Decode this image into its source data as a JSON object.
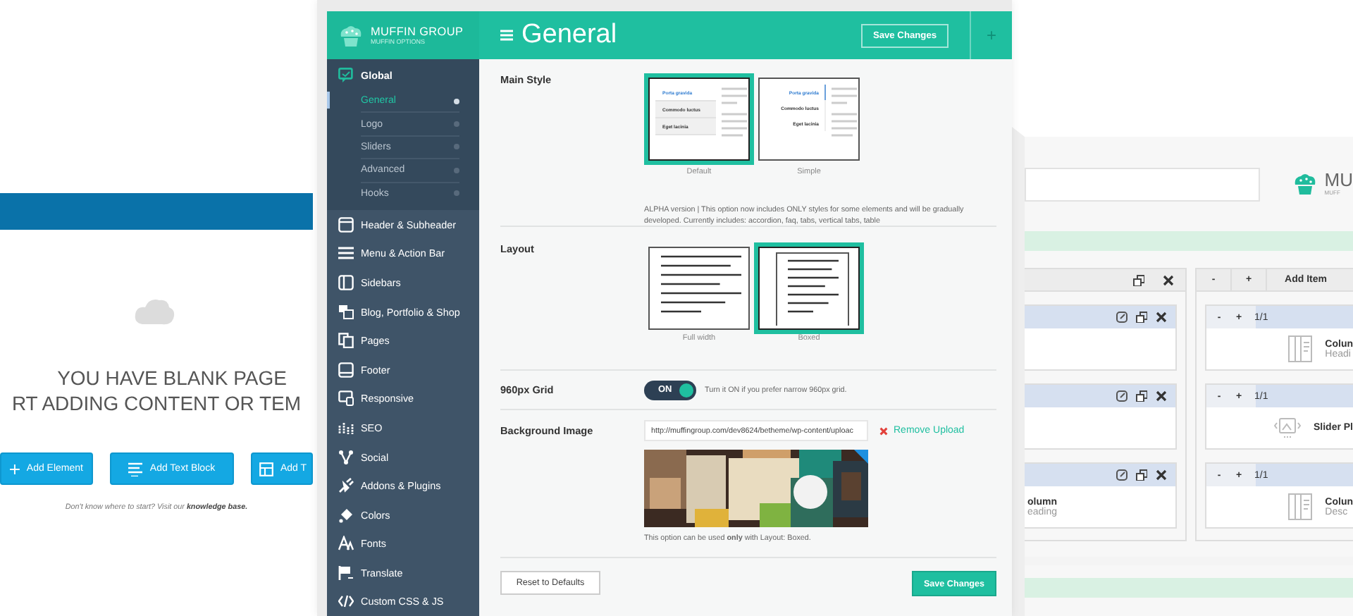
{
  "builder_left": {
    "heading": "YOU HAVE BLANK PAGE",
    "subheading": "RT ADDING CONTENT OR TEM",
    "buttons": [
      {
        "label": "Add Element"
      },
      {
        "label": "Add Text Block"
      },
      {
        "label": "Add T"
      }
    ],
    "hint": "Don't know where to start? Visit our **knowledge base.**"
  },
  "options": {
    "brand": {
      "title": "MUFFIN GROUP",
      "subtitle": "MUFFIN OPTIONS"
    },
    "menu": [
      {
        "label": "Global",
        "expanded": true,
        "children": [
          {
            "label": "General",
            "selected": true
          },
          {
            "label": "Logo",
            "selected": false
          },
          {
            "label": "Sliders",
            "selected": false
          },
          {
            "label": "Advanced",
            "selected": false
          },
          {
            "label": "Hooks",
            "selected": false
          }
        ]
      },
      {
        "label": "Header & Subheader",
        "expanded": false
      },
      {
        "label": "Menu & Action Bar",
        "expanded": false
      },
      {
        "label": "Sidebars",
        "expanded": false
      },
      {
        "label": "Blog, Portfolio & Shop",
        "expanded": false
      },
      {
        "label": "Pages",
        "expanded": false
      },
      {
        "label": "Footer",
        "expanded": false
      },
      {
        "label": "Responsive",
        "expanded": false
      },
      {
        "label": "SEO",
        "expanded": false
      },
      {
        "label": "Social",
        "expanded": false
      },
      {
        "label": "Addons & Plugins",
        "expanded": false
      },
      {
        "label": "Colors",
        "expanded": false
      },
      {
        "label": "Fonts",
        "expanded": false
      },
      {
        "label": "Translate",
        "expanded": false
      },
      {
        "label": "Custom CSS & JS",
        "expanded": false
      }
    ],
    "page_title": "General",
    "save_button": "Save Changes",
    "add_button": "+",
    "settings": [
      {
        "kind": "images",
        "label": "Main Style",
        "options": [
          {
            "kind": "boxedtabs",
            "caption": "Default",
            "selected": true,
            "tabs": [
              "Porta gravida",
              "Commodo luctus",
              "Eget lacinia"
            ]
          },
          {
            "kind": "plaintabs",
            "caption": "Simple",
            "selected": false,
            "tabs": [
              "Porta gravida",
              "Commodo luctus",
              "Eget lacinia"
            ]
          }
        ],
        "description": "ALPHA version | This option now includes ONLY styles for some elements and will be gradually developed.  Currently includes: accordion, faq, tabs, vertical tabs, table"
      },
      {
        "kind": "images",
        "label": "Layout",
        "options": [
          {
            "kind": "fullwidth",
            "caption": "Full width",
            "selected": false
          },
          {
            "kind": "boxed",
            "caption": "Boxed",
            "selected": true
          }
        ]
      },
      {
        "kind": "switch",
        "label": "960px Grid",
        "on": true,
        "switch_label": "ON",
        "description": "Turn it ON if you prefer narrow 960px grid."
      },
      {
        "kind": "upload",
        "label": "Background Image",
        "value": "http://muffingroup.com/dev8624/betheme/wp-content/uploac",
        "remove": "Remove Upload",
        "description": "This option can be used **only** with Layout: Boxed."
      }
    ],
    "reset_button": "Reset to Defaults",
    "footer_save_button": "Save Changes"
  },
  "builder_right": {
    "logo": {
      "title": "MU",
      "subtitle": "MUFF"
    },
    "left_box": {
      "items": [
        {
          "kind": "empty"
        },
        {
          "kind": "empty"
        },
        {
          "kind": "text",
          "title": "olumn",
          "subtitle": "eading"
        }
      ]
    },
    "right_box": {
      "toolbar": [
        "-",
        "+",
        "Add Item"
      ],
      "items": [
        {
          "kind": "column",
          "minus": "-",
          "plus": "+",
          "size": "1/1",
          "title": "Colun",
          "subtitle": "Headi"
        },
        {
          "kind": "slider",
          "minus": "-",
          "plus": "+",
          "size": "1/1",
          "title": "Slider Pl"
        },
        {
          "kind": "column",
          "minus": "-",
          "plus": "+",
          "size": "1/1",
          "title": "Colun",
          "subtitle": "Desc"
        }
      ]
    }
  }
}
